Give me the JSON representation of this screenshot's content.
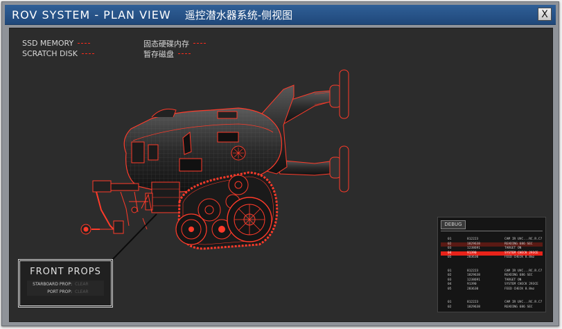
{
  "window": {
    "title_en": "ROV SYSTEM - PLAN VIEW",
    "title_cn": "遥控潜水器系统-侧视图",
    "close_label": "X"
  },
  "legend": {
    "left": [
      "SSD MEMORY",
      "SCRATCH DISK"
    ],
    "right": [
      "固态硬碟内存",
      "暂存磁盘"
    ]
  },
  "front_props": {
    "title": "FRONT PROPS",
    "rows": [
      {
        "label": "STARBOARD PROP:",
        "value": "CLEAR"
      },
      {
        "label": "PORT PROP:",
        "value": "CLEAR"
      }
    ]
  },
  "debug": {
    "header": "DEBUG",
    "groups": [
      [
        {
          "id": "01",
          "code": "812223",
          "msg": "CAM IR UVC...RC.R.C7"
        },
        {
          "id": "02",
          "code": "1829638",
          "msg": "READING 686 SEC"
        },
        {
          "id": "03",
          "code": "1238691",
          "msg": "TARGET ON"
        },
        {
          "id": "04",
          "code": "91390",
          "msg": "SYSTEM CHECK 293CE",
          "highlight": true
        },
        {
          "id": "05",
          "code": "283630",
          "msg": "FEED CHECK 8.8mz"
        }
      ],
      [
        {
          "id": "01",
          "code": "812223",
          "msg": "CAM IR UVC...RC.R.C7"
        },
        {
          "id": "02",
          "code": "1829638",
          "msg": "READING 686 SEC"
        },
        {
          "id": "03",
          "code": "1238691",
          "msg": "TARGET ON"
        },
        {
          "id": "04",
          "code": "91390",
          "msg": "SYSTEM CHECK 293CE"
        },
        {
          "id": "05",
          "code": "283630",
          "msg": "FEED CHECK 8.8mz"
        }
      ],
      [
        {
          "id": "01",
          "code": "812223",
          "msg": "CAM IR UVC...RC.R.C7"
        },
        {
          "id": "02",
          "code": "1829638",
          "msg": "READING 686 SEC"
        }
      ]
    ]
  },
  "colors": {
    "accent_red": "#ff2a1a",
    "titlebar_blue": "#2a5690",
    "stage_bg": "#2c2c2c"
  }
}
